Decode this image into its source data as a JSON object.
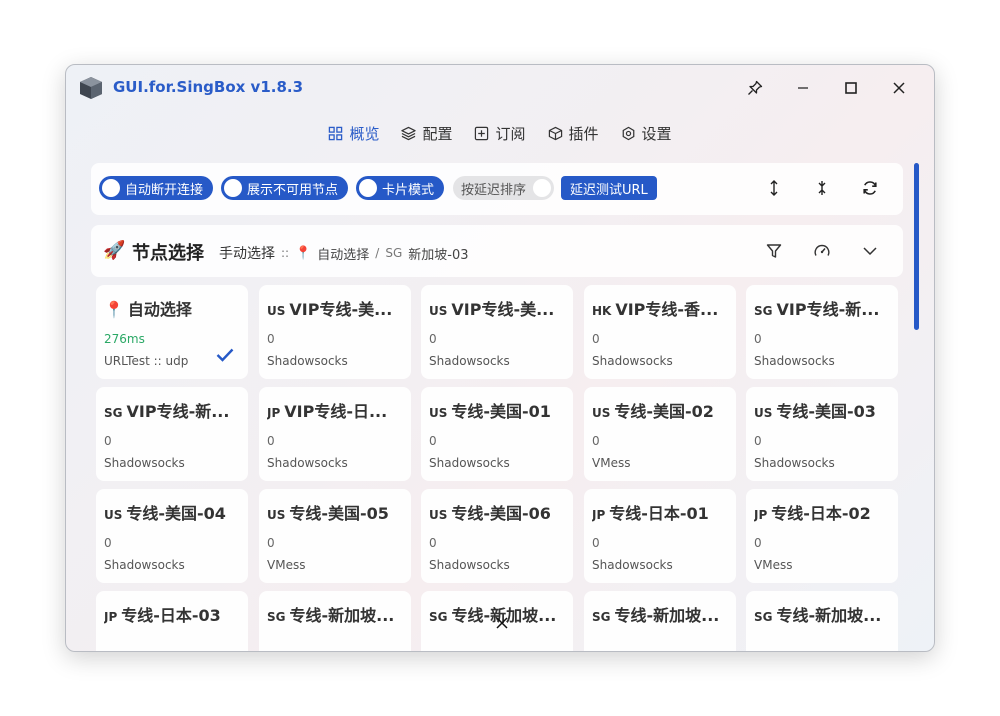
{
  "window": {
    "title": "GUI.for.SingBox v1.8.3"
  },
  "controls": {
    "pin": "pin-icon",
    "minimize": "minimize-icon",
    "maximize": "maximize-icon",
    "close": "close-icon"
  },
  "nav": [
    {
      "label": "概览",
      "icon": "grid-icon",
      "active": true
    },
    {
      "label": "配置",
      "icon": "layers-icon",
      "active": false
    },
    {
      "label": "订阅",
      "icon": "plus-square-icon",
      "active": false
    },
    {
      "label": "插件",
      "icon": "cube-icon",
      "active": false
    },
    {
      "label": "设置",
      "icon": "gear-icon",
      "active": false
    }
  ],
  "toolbar": {
    "auto_disconnect": "自动断开连接",
    "show_unavailable": "展示不可用节点",
    "card_mode": "卡片模式",
    "sort_by_delay": "按延迟排序",
    "delay_test_url": "延迟测试URL"
  },
  "group": {
    "title": "节点选择",
    "mode": "手动选择",
    "separator": "::",
    "auto": "自动选择",
    "slash": "/",
    "selected_cc": "SG",
    "selected": "新加坡-03"
  },
  "colors": {
    "accent": "#2659c7",
    "good_delay": "#2aa865"
  },
  "cards": [
    {
      "cc": "",
      "name": "自动选择",
      "pin": true,
      "delay": "276ms",
      "type": "URLTest :: udp",
      "selected": true
    },
    {
      "cc": "US",
      "name": "VIP专线-美...",
      "delay": "0",
      "type": "Shadowsocks"
    },
    {
      "cc": "US",
      "name": "VIP专线-美...",
      "delay": "0",
      "type": "Shadowsocks"
    },
    {
      "cc": "HK",
      "name": "VIP专线-香...",
      "delay": "0",
      "type": "Shadowsocks"
    },
    {
      "cc": "SG",
      "name": "VIP专线-新...",
      "delay": "0",
      "type": "Shadowsocks"
    },
    {
      "cc": "SG",
      "name": "VIP专线-新...",
      "delay": "0",
      "type": "Shadowsocks"
    },
    {
      "cc": "JP",
      "name": "VIP专线-日...",
      "delay": "0",
      "type": "Shadowsocks"
    },
    {
      "cc": "US",
      "name": "专线-美国-01",
      "delay": "0",
      "type": "Shadowsocks"
    },
    {
      "cc": "US",
      "name": "专线-美国-02",
      "delay": "0",
      "type": "VMess"
    },
    {
      "cc": "US",
      "name": "专线-美国-03",
      "delay": "0",
      "type": "Shadowsocks"
    },
    {
      "cc": "US",
      "name": "专线-美国-04",
      "delay": "0",
      "type": "Shadowsocks"
    },
    {
      "cc": "US",
      "name": "专线-美国-05",
      "delay": "0",
      "type": "VMess"
    },
    {
      "cc": "US",
      "name": "专线-美国-06",
      "delay": "0",
      "type": "Shadowsocks"
    },
    {
      "cc": "JP",
      "name": "专线-日本-01",
      "delay": "0",
      "type": "Shadowsocks"
    },
    {
      "cc": "JP",
      "name": "专线-日本-02",
      "delay": "0",
      "type": "VMess"
    },
    {
      "cc": "JP",
      "name": "专线-日本-03",
      "delay": "",
      "type": ""
    },
    {
      "cc": "SG",
      "name": "专线-新加坡...",
      "delay": "",
      "type": ""
    },
    {
      "cc": "SG",
      "name": "专线-新加坡...",
      "delay": "",
      "type": ""
    },
    {
      "cc": "SG",
      "name": "专线-新加坡...",
      "delay": "",
      "type": ""
    },
    {
      "cc": "SG",
      "name": "专线-新加坡...",
      "delay": "",
      "type": ""
    }
  ]
}
